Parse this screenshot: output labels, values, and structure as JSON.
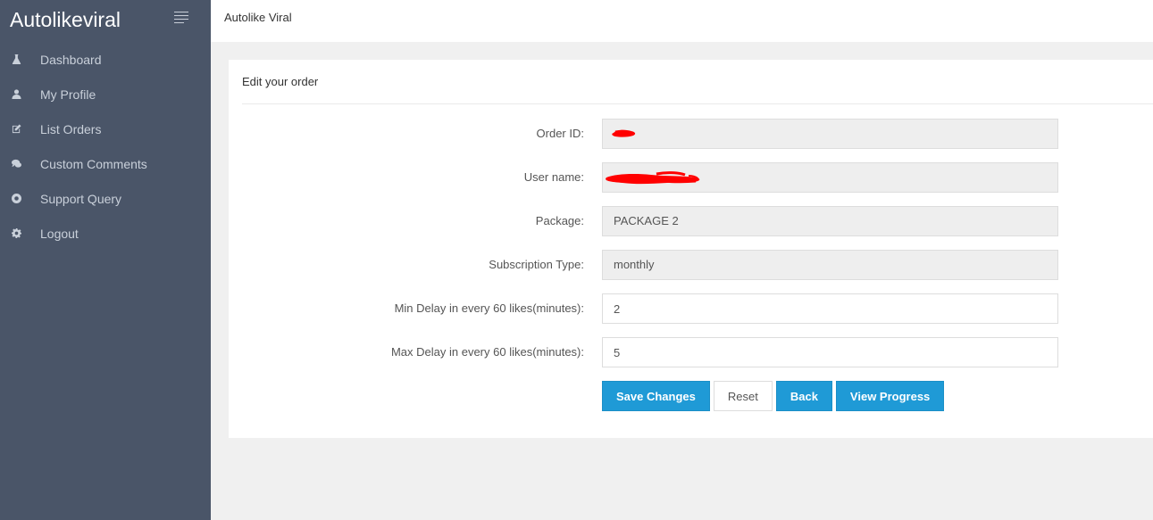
{
  "sidebar": {
    "brand": "Autolikeviral",
    "items": [
      {
        "label": "Dashboard",
        "icon": "flask-icon"
      },
      {
        "label": "My Profile",
        "icon": "user-icon"
      },
      {
        "label": "List Orders",
        "icon": "edit-icon"
      },
      {
        "label": "Custom Comments",
        "icon": "comments-icon"
      },
      {
        "label": "Support Query",
        "icon": "lifebuoy-icon"
      },
      {
        "label": "Logout",
        "icon": "gear-icon"
      }
    ]
  },
  "topbar": {
    "title": "Autolike Viral"
  },
  "panel": {
    "title": "Edit your order",
    "fields": [
      {
        "label": "Order ID:",
        "value": "",
        "editable": false,
        "redacted": true
      },
      {
        "label": "User name:",
        "value": "",
        "editable": false,
        "redacted": true
      },
      {
        "label": "Package:",
        "value": "PACKAGE 2",
        "editable": false
      },
      {
        "label": "Subscription Type:",
        "value": "monthly",
        "editable": false
      },
      {
        "label": "Min Delay in every 60 likes(minutes):",
        "value": "2",
        "editable": true
      },
      {
        "label": "Max Delay in every 60 likes(minutes):",
        "value": "5",
        "editable": true
      }
    ],
    "buttons": {
      "save": "Save Changes",
      "reset": "Reset",
      "back": "Back",
      "progress": "View Progress"
    }
  },
  "colors": {
    "sidebar_bg": "#4a5568",
    "primary": "#1f9ad6",
    "redaction": "#ff0000"
  }
}
